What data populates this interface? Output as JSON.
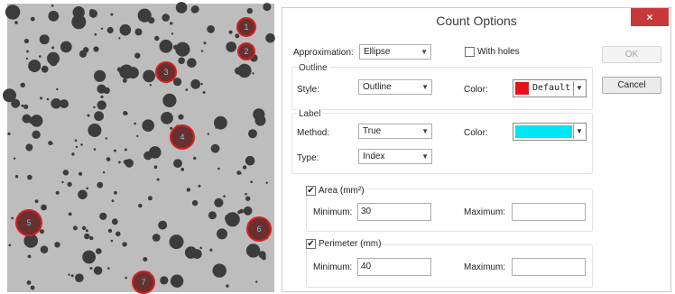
{
  "dialog": {
    "title": "Count Options",
    "close_label": "×",
    "approximation": {
      "label": "Approximation:",
      "value": "Ellipse"
    },
    "with_holes": {
      "label": "With holes",
      "checked": false
    },
    "ok_label": "OK",
    "cancel_label": "Cancel",
    "outline": {
      "section": "Outline",
      "style_label": "Style:",
      "style_value": "Outline",
      "color_label": "Color:",
      "color_text": "Default",
      "color": "#e8101a"
    },
    "label": {
      "section": "Label",
      "method_label": "Method:",
      "method_value": "True",
      "color_label": "Color:",
      "color": "#00e5f5",
      "type_label": "Type:",
      "type_value": "Index"
    },
    "area": {
      "label": "Area (mm²)",
      "checked": true,
      "minimum_label": "Minimum:",
      "minimum_value": "30",
      "maximum_label": "Maximum:",
      "maximum_value": ""
    },
    "perimeter": {
      "label": "Perimeter (mm)",
      "checked": true,
      "minimum_label": "Minimum:",
      "minimum_value": "40",
      "maximum_label": "Maximum:",
      "maximum_value": ""
    }
  },
  "image": {
    "background": "#bdbdbd",
    "particle_color": "#3c3c3c",
    "outline_color": "#d61f1f",
    "label_color": "#5fd0e6",
    "labels": [
      "1",
      "2",
      "3",
      "4",
      "5",
      "6",
      "7"
    ]
  }
}
